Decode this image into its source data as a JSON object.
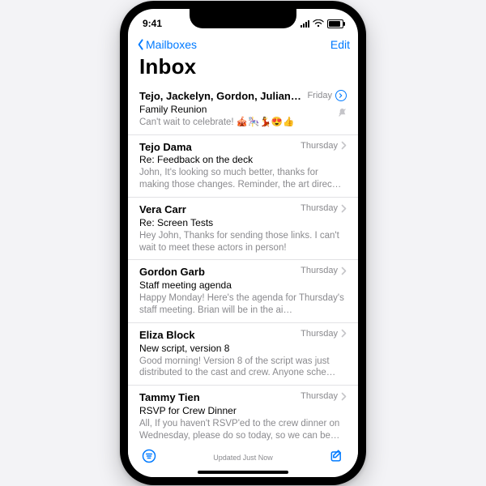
{
  "status": {
    "time": "9:41"
  },
  "nav": {
    "back": "Mailboxes",
    "edit": "Edit"
  },
  "title": "Inbox",
  "toolbar": {
    "updated": "Updated Just Now",
    "filter_icon": "filter-icon",
    "compose_icon": "compose-icon"
  },
  "emails": [
    {
      "sender": "Tejo, Jackelyn, Gordon, Juliana...",
      "date": "Friday",
      "subject": "Family Reunion",
      "preview": "Can't wait to celebrate! 🎪🎠💃😍👍",
      "thread": true,
      "muted": true
    },
    {
      "sender": "Tejo Dama",
      "date": "Thursday",
      "subject": "Re: Feedback on the deck",
      "preview": "John, It's looking so much better, thanks for making those changes. Reminder, the art direc…"
    },
    {
      "sender": "Vera Carr",
      "date": "Thursday",
      "subject": "Re: Screen Tests",
      "preview": "Hey John, Thanks for sending those links. I can't wait to meet these actors in person!"
    },
    {
      "sender": "Gordon Garb",
      "date": "Thursday",
      "subject": "Staff meeting agenda",
      "preview": "Happy Monday! Here's the agenda for Thursday's staff meeting. Brian will be in the ai…"
    },
    {
      "sender": "Eliza Block",
      "date": "Thursday",
      "subject": "New script, version 8",
      "preview": "Good morning! Version 8 of the script was just distributed to the cast and crew. Anyone sche…"
    },
    {
      "sender": "Tammy Tien",
      "date": "Thursday",
      "subject": "RSVP for Crew Dinner",
      "preview": "All, If you haven't RSVP'ed to the crew dinner on Wednesday, please do so today, so we can be…"
    }
  ]
}
